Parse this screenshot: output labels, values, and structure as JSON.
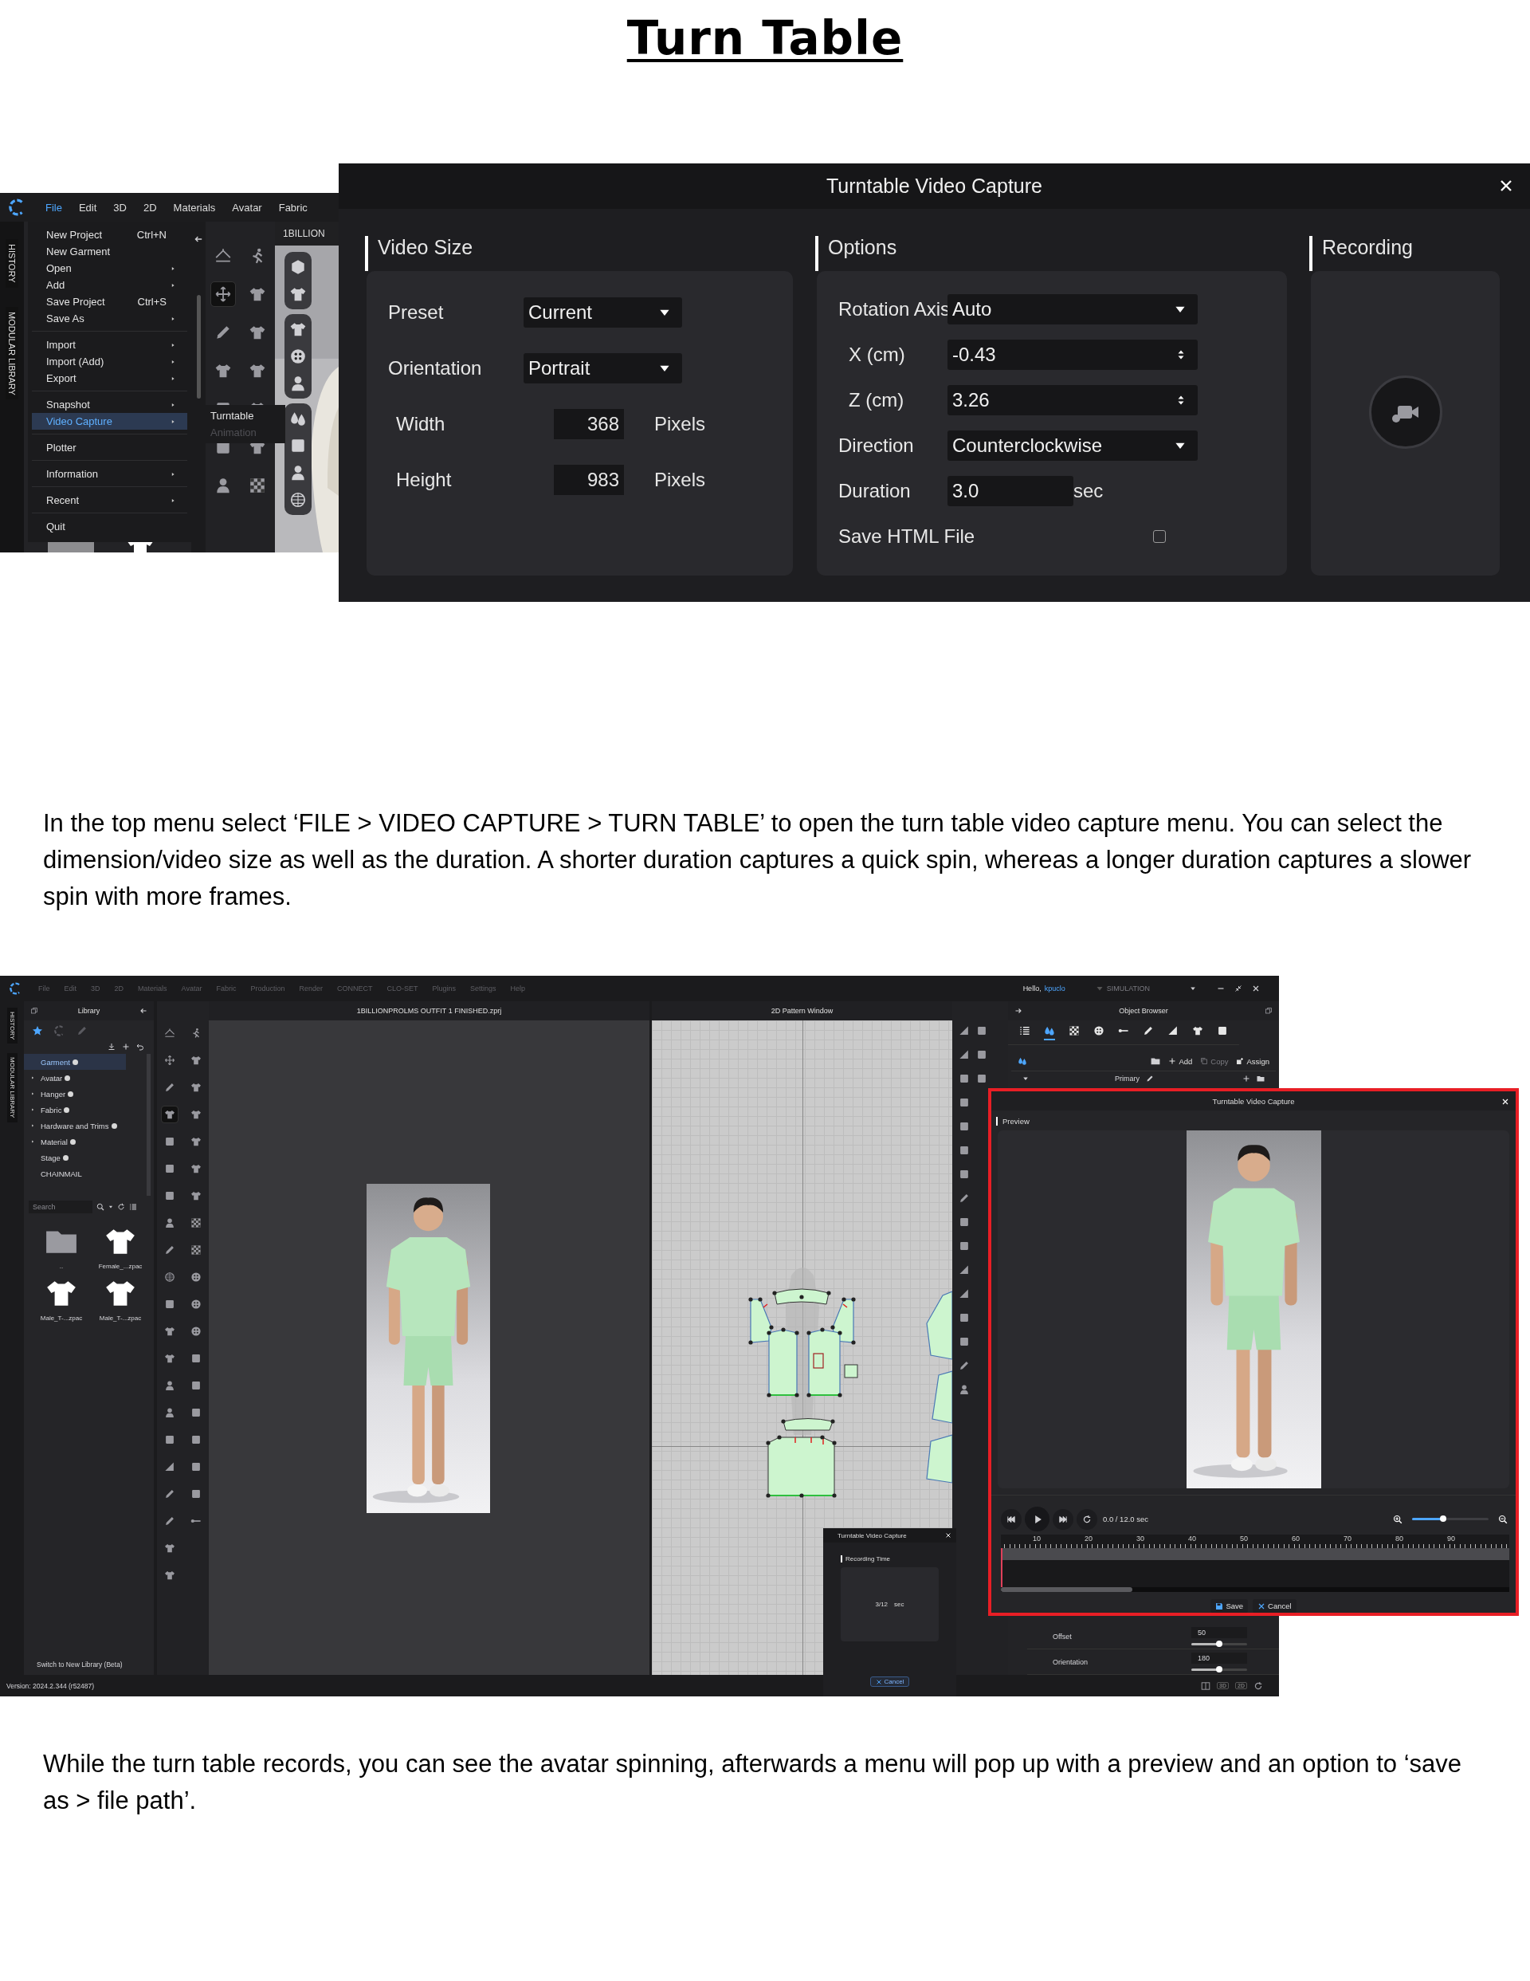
{
  "title": "Turn Table",
  "figure_1": {
    "app": {
      "menubar": [
        {
          "label": "File",
          "selected": true
        },
        {
          "label": "Edit",
          "selected": false
        },
        {
          "label": "3D",
          "selected": false
        },
        {
          "label": "2D",
          "selected": false
        },
        {
          "label": "Materials",
          "selected": false
        },
        {
          "label": "Avatar",
          "selected": false
        },
        {
          "label": "Fabric",
          "selected": false
        }
      ],
      "side_tabs": [
        "HISTORY",
        "MODULAR LIBRARY"
      ],
      "file_menu": [
        [
          {
            "label": "New Project",
            "shortcut": "Ctrl+N",
            "submenu": false,
            "highlighted": false
          },
          {
            "label": "New Garment",
            "submenu": false,
            "highlighted": false
          },
          {
            "label": "Open",
            "submenu": true,
            "highlighted": false
          },
          {
            "label": "Add",
            "submenu": true,
            "highlighted": false
          },
          {
            "label": "Save Project",
            "shortcut": "Ctrl+S",
            "submenu": false,
            "highlighted": false
          },
          {
            "label": "Save As",
            "submenu": true,
            "highlighted": false
          }
        ],
        [
          {
            "label": "Import",
            "submenu": true,
            "highlighted": false
          },
          {
            "label": "Import (Add)",
            "submenu": true,
            "highlighted": false
          },
          {
            "label": "Export",
            "submenu": true,
            "highlighted": false
          }
        ],
        [
          {
            "label": "Snapshot",
            "submenu": true,
            "highlighted": false
          },
          {
            "label": "Video Capture",
            "submenu": true,
            "highlighted": true
          }
        ],
        [
          {
            "label": "Plotter",
            "submenu": false,
            "highlighted": false
          }
        ],
        [
          {
            "label": "Information",
            "submenu": true,
            "highlighted": false
          }
        ],
        [
          {
            "label": "Recent",
            "submenu": true,
            "highlighted": false
          }
        ],
        [
          {
            "label": "Quit",
            "submenu": false,
            "highlighted": false
          }
        ]
      ],
      "submenu": [
        {
          "label": "Turntable",
          "disabled": false
        },
        {
          "label": "Animation",
          "disabled": true
        }
      ],
      "document_title": "1BILLION"
    },
    "dialog": {
      "title": "Turntable Video Capture",
      "sections": [
        {
          "heading": "Video Size",
          "rows": [
            {
              "kind": "select",
              "label": "Preset",
              "value": "Current"
            },
            {
              "kind": "select",
              "label": "Orientation",
              "value": "Portrait"
            },
            {
              "kind": "number",
              "label": "Width",
              "value": "368",
              "unit": "Pixels"
            },
            {
              "kind": "number",
              "label": "Height",
              "value": "983",
              "unit": "Pixels"
            }
          ]
        },
        {
          "heading": "Options",
          "rows": [
            {
              "kind": "select",
              "label": "Rotation Axis",
              "value": "Auto"
            },
            {
              "kind": "spin",
              "label": "X (cm)",
              "value": "-0.43"
            },
            {
              "kind": "spin",
              "label": "Z (cm)",
              "value": "3.26"
            },
            {
              "kind": "select",
              "label": "Direction",
              "value": "Counterclockwise"
            },
            {
              "kind": "text",
              "label": "Duration",
              "value": "3.0",
              "unit": "sec"
            },
            {
              "kind": "checkbox",
              "label": "Save HTML File",
              "checked": false
            }
          ]
        },
        {
          "heading": "Recording",
          "rows": [
            {
              "kind": "record"
            }
          ]
        }
      ]
    }
  },
  "paragraph_1": "In the top menu select ‘FILE > VIDEO CAPTURE > TURN TABLE’ to open the turn table video capture menu. You can select the dimension/video size as well as the duration. A shorter duration captures a quick spin, whereas a longer duration captures a slower spin with more frames.",
  "figure_2": {
    "menubar": {
      "disabled": true,
      "items": [
        "File",
        "Edit",
        "3D",
        "2D",
        "Materials",
        "Avatar",
        "Fabric",
        "Production",
        "Render",
        "CONNECT",
        "CLO-SET",
        "Plugins",
        "Settings",
        "Help"
      ]
    },
    "greeting": "Hello,",
    "user": "kpuclo",
    "simulation": {
      "label": "SIMULATION",
      "disabled": true
    },
    "side_tabs": [
      "HISTORY",
      "MODULAR LIBRARY"
    ],
    "library": {
      "title": "Library",
      "tabs": [
        {
          "selected": true
        },
        {
          "selected": false
        },
        {
          "selected": false
        }
      ],
      "tree": [
        {
          "label": "Garment",
          "selected": true,
          "expandable": false,
          "new": true
        },
        {
          "label": "Avatar",
          "selected": false,
          "expandable": true,
          "new": true
        },
        {
          "label": "Hanger",
          "selected": false,
          "expandable": true,
          "new": true
        },
        {
          "label": "Fabric",
          "selected": false,
          "expandable": true,
          "new": true
        },
        {
          "label": "Hardware and Trims",
          "selected": false,
          "expandable": true,
          "new": true
        },
        {
          "label": "Material",
          "selected": false,
          "expandable": true,
          "new": true
        },
        {
          "label": "Stage",
          "selected": false,
          "expandable": false,
          "new": true
        },
        {
          "label": "CHAINMAIL",
          "selected": false,
          "expandable": false,
          "new": false
        }
      ],
      "search": {
        "placeholder": "Search"
      },
      "files": [
        {
          "kind": "folder",
          "name": ".."
        },
        {
          "kind": "file",
          "name": "Female_...zpac"
        },
        {
          "kind": "file",
          "name": "Male_T-...zpac"
        },
        {
          "kind": "file",
          "name": "Male_T-...zpac"
        }
      ],
      "switch_link": "Switch to New Library (Beta)"
    },
    "viewport": {
      "title": "1BILLIONPROLMS OUTFIT 1 FINISHED.zprj"
    },
    "pattern_window": {
      "title": "2D Pattern Window"
    },
    "recording_dialog": {
      "title": "Turntable Video Capture",
      "heading": "Recording Time",
      "time": "3/12",
      "unit": "sec",
      "cancel": "Cancel"
    },
    "object_browser": {
      "title": "Object Browser",
      "tabs": [
        {
          "selected": false
        },
        {
          "selected": true
        },
        {
          "selected": false
        },
        {
          "selected": false
        },
        {
          "selected": false
        },
        {
          "selected": false
        },
        {
          "selected": false
        },
        {
          "selected": false
        },
        {
          "selected": false
        }
      ],
      "actions": [
        {
          "label": "Add",
          "disabled": false
        },
        {
          "label": "Copy",
          "disabled": true
        },
        {
          "label": "Assign",
          "disabled": false
        }
      ],
      "colorway": "Primary",
      "properties": [
        {
          "label": "Offset",
          "value": "50",
          "level": 0.5
        },
        {
          "label": "Orientation",
          "value": "180",
          "level": 0.5
        }
      ],
      "footer_buttons": [
        "3D",
        "2D"
      ]
    },
    "preview_dialog": {
      "title": "Turntable Video Capture",
      "heading": "Preview",
      "time": "0.0 / 12.0 sec",
      "zoom": {
        "level": 0.41
      },
      "timeline_labels": [
        "10",
        "20",
        "30",
        "40",
        "50",
        "60",
        "70",
        "80",
        "90"
      ],
      "buttons": [
        {
          "kind": "save",
          "label": "Save"
        },
        {
          "kind": "cancel",
          "label": "Cancel"
        }
      ]
    },
    "version": "Version: 2024.2.344 (r52487)"
  },
  "paragraph_2": "While the turn table records, you can see the avatar spinning, afterwards a menu will pop up with a preview and an option to ‘save as > file path’."
}
